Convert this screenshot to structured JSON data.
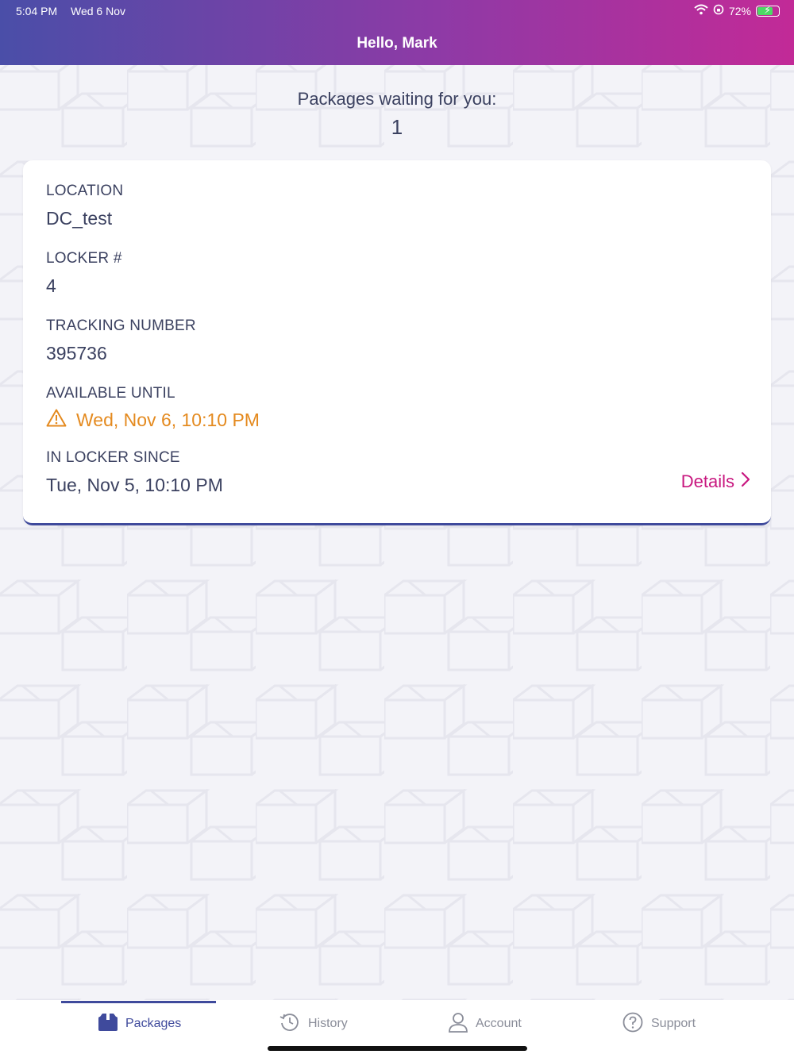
{
  "status_bar": {
    "time": "5:04 PM",
    "date": "Wed 6 Nov",
    "battery": "72%",
    "icons": [
      "wifi-icon",
      "orientation-lock-icon",
      "battery-icon"
    ]
  },
  "header": {
    "title": "Hello, Mark"
  },
  "summary": {
    "label": "Packages waiting for you:",
    "count": "1"
  },
  "package": {
    "location_label": "LOCATION",
    "location_value": "DC_test",
    "locker_label": "LOCKER #",
    "locker_value": "4",
    "tracking_label": "TRACKING NUMBER",
    "tracking_value": "395736",
    "available_label": "AVAILABLE UNTIL",
    "available_value": "Wed, Nov 6, 10:10 PM",
    "since_label": "IN LOCKER SINCE",
    "since_value": "Tue, Nov 5, 10:10 PM",
    "details_label": "Details"
  },
  "tabs": [
    {
      "label": "Packages",
      "icon": "package-icon",
      "active": true
    },
    {
      "label": "History",
      "icon": "history-icon",
      "active": false
    },
    {
      "label": "Account",
      "icon": "account-icon",
      "active": false
    },
    {
      "label": "Support",
      "icon": "help-icon",
      "active": false
    }
  ],
  "colors": {
    "accent": "#3f4a9c",
    "link": "#c8177f",
    "warning": "#e48a1f",
    "header_gradient": [
      "#4a4ea8",
      "#c22a97"
    ]
  }
}
